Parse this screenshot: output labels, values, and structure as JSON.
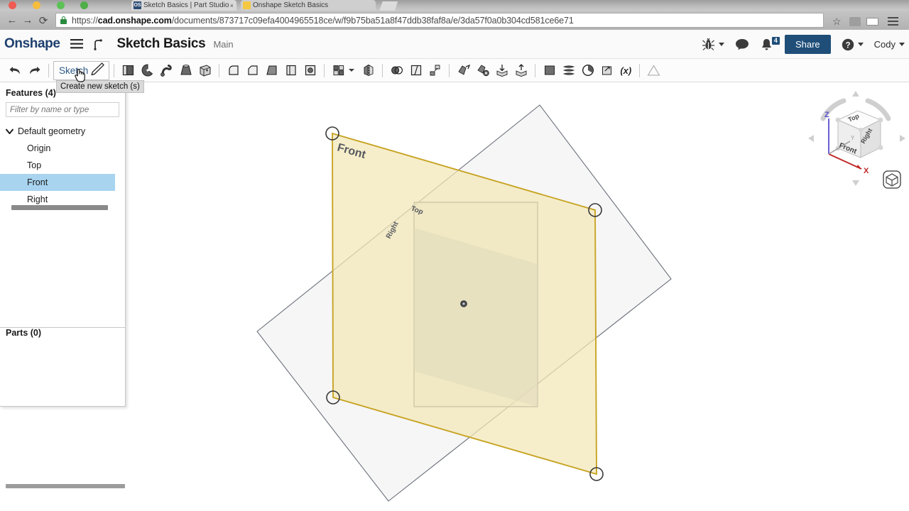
{
  "browser": {
    "tabs": [
      {
        "title": "Sketch Basics | Part Studio",
        "favicon": "onshape-icon",
        "active": true,
        "close_label": "×"
      },
      {
        "title": "Onshape Sketch Basics",
        "favicon": "folder-icon",
        "active": false,
        "close_label": ""
      }
    ],
    "nav": {
      "back": "←",
      "forward": "→",
      "reload": "⟳"
    },
    "url_scheme": "https://",
    "url_host": "cad.onshape.com",
    "url_path": "/documents/873717c09efa4004965518ce/w/f9b75ba51a8f47ddb38faf8a/e/3da57f0a0b304cd581ce6e71",
    "url_full": "https://cad.onshape.com/documents/873717c09efa4004965518ce/w/f9b75ba51a8f47ddb38faf8a/e/3da57f0a0b304cd581ce6e71",
    "bookmark_icon": "☆",
    "menu_icon": "hamburger-menu-icon"
  },
  "header": {
    "logo": "Onshape",
    "menu_icon": "hamburger-menu-icon",
    "branch_icon": "branch-icon",
    "document_title": "Sketch Basics",
    "workspace": "Main",
    "bug_icon": "bug-icon",
    "comment_icon": "comment-icon",
    "notification_icon": "bell-icon",
    "notification_count": "4",
    "share_label": "Share",
    "help_icon": "question-mark-icon",
    "user_name": "Cody"
  },
  "toolbar": {
    "undo_icon": "undo-arrow-icon",
    "redo_icon": "redo-arrow-icon",
    "sketch_label": "Sketch",
    "sketch_pencil_icon": "pencil-icon",
    "tooltip": "Create new sketch (s)",
    "cursor": "hand-pointer-cursor",
    "icons": [
      "extrude-icon",
      "revolve-icon",
      "sweep-icon",
      "loft-icon",
      "thicken-icon",
      "fillet-icon",
      "chamfer-icon",
      "draft-icon",
      "shell-icon",
      "hole-icon",
      "plane-icon",
      "mirror-icon",
      "boolean-icon",
      "split-icon",
      "transform-icon",
      "move-face-icon",
      "delete-face-icon",
      "pattern-icon",
      "delete-part-icon",
      "import-icon",
      "export-icon",
      "part-icon",
      "layers-icon",
      "history-icon",
      "derive-icon",
      "variable-icon",
      "warning-icon"
    ],
    "variable_label": "(x)"
  },
  "features_panel": {
    "title": "Features (4)",
    "filter_placeholder": "Filter by name or type",
    "filter_value": "",
    "tree": {
      "group_label": "Default geometry",
      "group_expanded": true,
      "items": [
        {
          "label": "Origin",
          "selected": false
        },
        {
          "label": "Top",
          "selected": false
        },
        {
          "label": "Front",
          "selected": true
        },
        {
          "label": "Right",
          "selected": false
        }
      ]
    }
  },
  "parts_panel": {
    "title": "Parts (0)"
  },
  "viewport": {
    "planes": [
      {
        "name": "Front",
        "label": "Front",
        "state": "selected",
        "fill": "#f5edc0",
        "stroke": "#c8a424"
      },
      {
        "name": "Top",
        "label": "Top",
        "state": "normal",
        "fill": "#f2f2f2",
        "stroke": "#6a7079"
      },
      {
        "name": "Right",
        "label": "Right",
        "state": "normal",
        "fill": "#ececec",
        "stroke": "#6a7079"
      }
    ],
    "origin_label": "origin-point"
  },
  "view_cube": {
    "faces": {
      "top": "Top",
      "front": "Front",
      "right": "Right"
    },
    "axes": [
      {
        "label": "Z",
        "color": "#5a4fcf"
      },
      {
        "label": "X",
        "color": "#c02626"
      },
      {
        "label": "Y",
        "color": "#9a9a9a"
      }
    ],
    "arrows": [
      "up",
      "down",
      "left",
      "right",
      "rotate-cw",
      "rotate-ccw"
    ],
    "home_icon": "view-home-cube-icon"
  },
  "colors": {
    "brand": "#1d3f6e",
    "accent_blue": "#1f4e79",
    "selection": "#a8d4f0",
    "plane_selected": "#c8a424"
  }
}
